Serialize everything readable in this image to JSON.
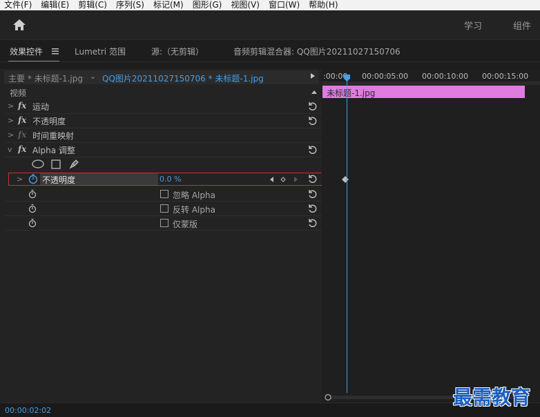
{
  "menu": [
    "文件(F)",
    "编辑(E)",
    "剪辑(C)",
    "序列(S)",
    "标记(M)",
    "图形(G)",
    "视图(V)",
    "窗口(W)",
    "帮助(H)"
  ],
  "workspaces": {
    "learn": "学习",
    "assembly": "组件"
  },
  "panel_tabs": {
    "effect_controls": "效果控件",
    "lumetri": "Lumetri 范围",
    "source": "源:（无剪辑）",
    "audio_mixer": "音频剪辑混合器: QQ图片20211027150706"
  },
  "source": {
    "master": "主要 * 未标题-1.jpg",
    "clip": "QQ图片20211027150706 * 未标题-1.jpg"
  },
  "video_header": "视频",
  "effects": [
    {
      "name": "运动"
    },
    {
      "name": "不透明度"
    },
    {
      "name": "时间重映射"
    },
    {
      "name": "Alpha 调整"
    }
  ],
  "fx_symbol": "fx",
  "alpha": {
    "opacity_label": "不透明度",
    "opacity_value": "0.0 %",
    "ignore_alpha": "忽略 Alpha",
    "invert_alpha": "反转 Alpha",
    "mask_only": "仅蒙版"
  },
  "timeline": {
    "ticks": [
      ":00:00",
      "00:00:05:00",
      "00:00:10:00",
      "00:00:15:00"
    ],
    "clip_name": "未标题-1.jpg",
    "clip_color": "#e07be0",
    "playhead_color": "#4a9de0"
  },
  "timecode": "00:00:02:02",
  "watermark": "最需教育"
}
